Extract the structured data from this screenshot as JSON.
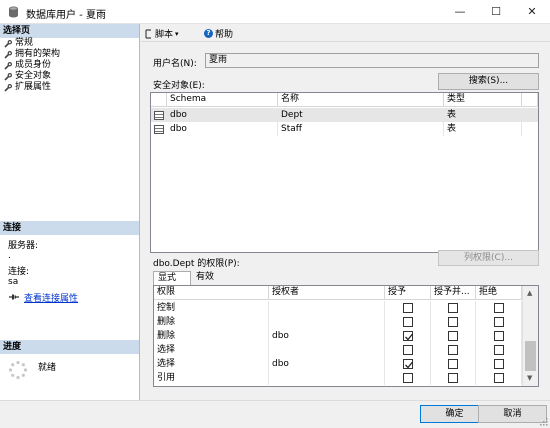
{
  "window": {
    "title": "数据库用户 - 夏雨",
    "min_glyph": "—",
    "max_glyph": "☐",
    "close_glyph": "✕"
  },
  "left_pane": {
    "select_page_header": "选择页",
    "pages": [
      "常规",
      "拥有的架构",
      "成员身份",
      "安全对象",
      "扩展属性"
    ],
    "connection_header": "连接",
    "server_label": "服务器:",
    "server_value": ".",
    "connection_label": "连接:",
    "connection_value": "sa",
    "view_connection_props": "查看连接属性",
    "progress_header": "进度",
    "progress_status": "就绪"
  },
  "toolbar": {
    "script_label": "脚本",
    "help_label": "帮助"
  },
  "form": {
    "username_label": "用户名(N):",
    "username_value": "夏雨",
    "securables_label": "安全对象(E):",
    "search_button": "搜索(S)..."
  },
  "securables_grid": {
    "columns": [
      "Schema",
      "名称",
      "类型"
    ],
    "rows": [
      {
        "schema": "dbo",
        "name": "Dept",
        "type": "表"
      },
      {
        "schema": "dbo",
        "name": "Staff",
        "type": "表"
      }
    ]
  },
  "permissions": {
    "label": "dbo.Dept 的权限(P):",
    "column_perm_button": "列权限(C)...",
    "tabs": [
      "显式",
      "有效"
    ],
    "columns": [
      "权限",
      "授权者",
      "授予",
      "授予并...",
      "拒绝"
    ],
    "rows": [
      {
        "permission": "控制",
        "grantor": "",
        "grant": false,
        "with_grant": false,
        "deny": false
      },
      {
        "permission": "删除",
        "grantor": "",
        "grant": false,
        "with_grant": false,
        "deny": false
      },
      {
        "permission": "删除",
        "grantor": "dbo",
        "grant": true,
        "with_grant": false,
        "deny": false
      },
      {
        "permission": "选择",
        "grantor": "",
        "grant": false,
        "with_grant": false,
        "deny": false
      },
      {
        "permission": "选择",
        "grantor": "dbo",
        "grant": true,
        "with_grant": false,
        "deny": false
      },
      {
        "permission": "引用",
        "grantor": "",
        "grant": false,
        "with_grant": false,
        "deny": false
      }
    ]
  },
  "footer": {
    "ok_button": "确定",
    "cancel_button": "取消"
  },
  "colors": {
    "header_bg": "#ccdbec",
    "link": "#0033cc",
    "selected_row": "#e6e6e6"
  }
}
